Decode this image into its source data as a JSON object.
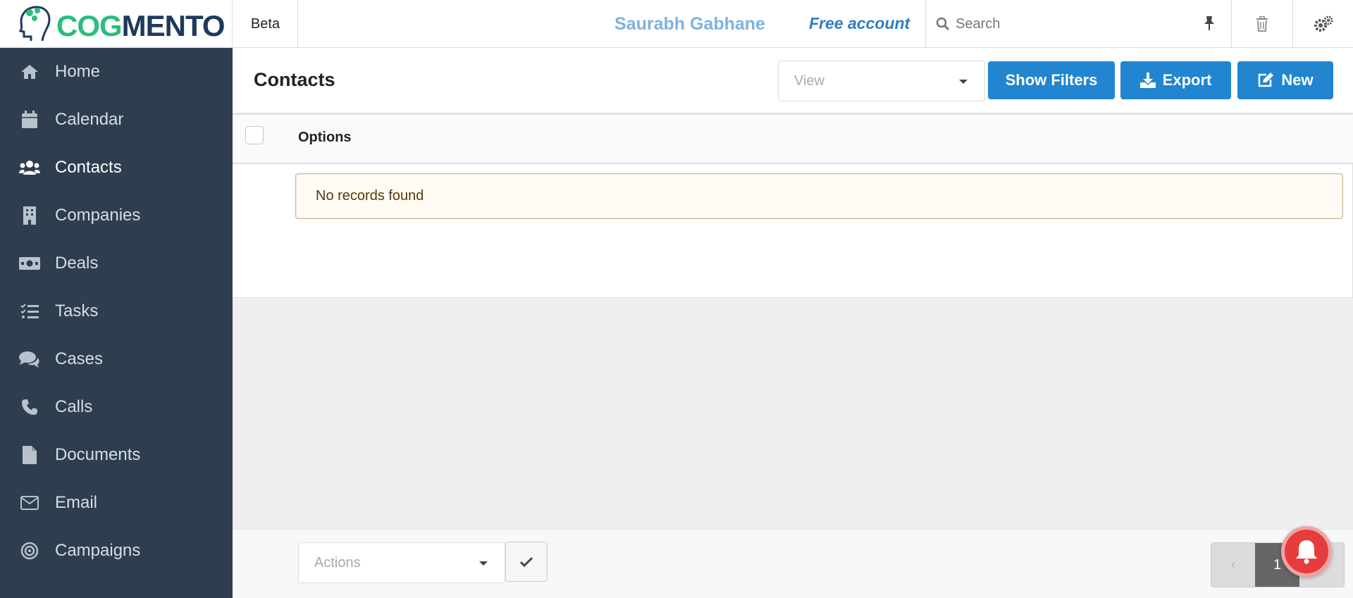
{
  "header": {
    "logo_text_part1": "COG",
    "logo_text_part2": "MENTO",
    "beta_label": "Beta",
    "user_name": "Saurabh Gabhane",
    "account_type": "Free account",
    "search_placeholder": "Search"
  },
  "sidebar": {
    "items": [
      {
        "label": "Home",
        "icon": "home-icon"
      },
      {
        "label": "Calendar",
        "icon": "calendar-icon"
      },
      {
        "label": "Contacts",
        "icon": "users-icon",
        "active": true
      },
      {
        "label": "Companies",
        "icon": "building-icon"
      },
      {
        "label": "Deals",
        "icon": "money-icon"
      },
      {
        "label": "Tasks",
        "icon": "tasks-icon"
      },
      {
        "label": "Cases",
        "icon": "comments-icon"
      },
      {
        "label": "Calls",
        "icon": "phone-icon"
      },
      {
        "label": "Documents",
        "icon": "file-icon"
      },
      {
        "label": "Email",
        "icon": "envelope-icon"
      },
      {
        "label": "Campaigns",
        "icon": "bullseye-icon"
      }
    ]
  },
  "main": {
    "title": "Contacts",
    "view_placeholder": "View",
    "buttons": {
      "show_filters": "Show Filters",
      "export": "Export",
      "new": "New"
    },
    "table": {
      "columns": [
        "Options"
      ],
      "empty_message": "No records found"
    }
  },
  "footer": {
    "actions_placeholder": "Actions",
    "current_page": "1"
  },
  "colors": {
    "sidebar_bg": "#2e3e4e",
    "primary_button": "#2185d0",
    "notification": "#e63c3c",
    "logo_green": "#2bbd7e",
    "logo_navy": "#1d3a5c"
  }
}
